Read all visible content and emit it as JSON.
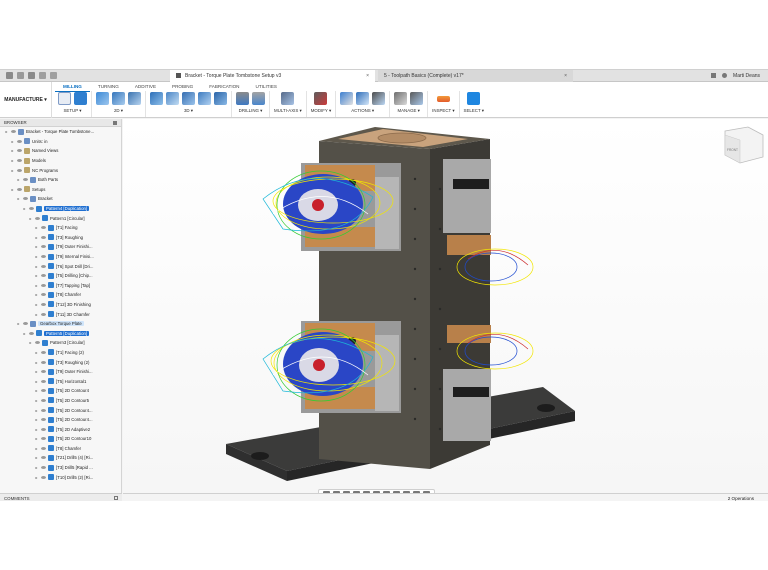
{
  "titlebar": {
    "active_tab": "Bracket - Torque Plate Tombstone Setup v3",
    "other_tab": "5 - Toolpath Basics (Complete) v17*",
    "user": "Marti Deans",
    "close": "×"
  },
  "ribbon": {
    "workspace": "MANUFACTURE ▾",
    "tabs": [
      "MILLING",
      "TURNING",
      "ADDITIVE",
      "PROBING",
      "FABRICATION",
      "UTILITIES"
    ],
    "groups": [
      "SETUP ▾",
      "2D ▾",
      "3D ▾",
      "DRILLING ▾",
      "MULTI-AXIS ▾",
      "MODIFY ▾",
      "ACTIONS ▾",
      "MANAGE ▾",
      "INSPECT ▾",
      "SELECT ▾"
    ]
  },
  "browser": {
    "header": "BROWSER",
    "rows": [
      {
        "d": 0,
        "text": "Bracket - Torque Plate Tombstone...",
        "icon": "doc"
      },
      {
        "d": 1,
        "text": "Units: in",
        "icon": "doc"
      },
      {
        "d": 1,
        "text": "Named Views",
        "icon": "folder"
      },
      {
        "d": 1,
        "text": "Models",
        "icon": "folder"
      },
      {
        "d": 1,
        "text": "NC Programs",
        "icon": "folder"
      },
      {
        "d": 2,
        "text": "Both Parts",
        "icon": "doc"
      },
      {
        "d": 1,
        "text": "Setups",
        "icon": "folder"
      },
      {
        "d": 2,
        "text": "Bracket",
        "icon": "setup"
      },
      {
        "d": 3,
        "text": "Pattern4 [Duplication]",
        "icon": "tp",
        "style": "sel"
      },
      {
        "d": 4,
        "text": "Pattern1 [Circular]",
        "icon": "tp"
      },
      {
        "d": 5,
        "text": "[T1] Facing",
        "icon": "tp"
      },
      {
        "d": 5,
        "text": "[T3] Roughing",
        "icon": "tp"
      },
      {
        "d": 5,
        "text": "[T9] Outer Finishi...",
        "icon": "tp"
      },
      {
        "d": 5,
        "text": "[T9] Internal Finisi...",
        "icon": "tp"
      },
      {
        "d": 5,
        "text": "[T6] Spot Drill [Dri...",
        "icon": "tp"
      },
      {
        "d": 5,
        "text": "[T5] Drilling [Chip...",
        "icon": "tp"
      },
      {
        "d": 5,
        "text": "[T7] Tapping [Tap]",
        "icon": "tp"
      },
      {
        "d": 5,
        "text": "[T8] Chamfer",
        "icon": "tp"
      },
      {
        "d": 5,
        "text": "[T12] 3D Finishing",
        "icon": "tp"
      },
      {
        "d": 5,
        "text": "[T11] 3D Chamfer",
        "icon": "tp"
      },
      {
        "d": 2,
        "text": "Gearbox Torque Plate",
        "icon": "setup",
        "style": "hl"
      },
      {
        "d": 3,
        "text": "Pattern5 [Duplication]",
        "icon": "tp",
        "style": "sel"
      },
      {
        "d": 4,
        "text": "Pattern3 [Circular]",
        "icon": "tp"
      },
      {
        "d": 5,
        "text": "[T1] Facing (2)",
        "icon": "tp"
      },
      {
        "d": 5,
        "text": "[T3] Roughing (2)",
        "icon": "tp"
      },
      {
        "d": 5,
        "text": "[T9] Outer Finishi...",
        "icon": "tp"
      },
      {
        "d": 5,
        "text": "[T5] Horizontal1",
        "icon": "tp"
      },
      {
        "d": 5,
        "text": "[T5] 2D Contour4",
        "icon": "tp"
      },
      {
        "d": 5,
        "text": "[T5] 2D Contour5",
        "icon": "tp"
      },
      {
        "d": 5,
        "text": "[T5] 2D Contour4...",
        "icon": "tp"
      },
      {
        "d": 5,
        "text": "[T5] 2D Contour4...",
        "icon": "tp"
      },
      {
        "d": 5,
        "text": "[T5] 2D Adaptive2",
        "icon": "tp"
      },
      {
        "d": 5,
        "text": "[T5] 2D Contour10",
        "icon": "tp"
      },
      {
        "d": 5,
        "text": "[T8] Chamfer",
        "icon": "tp"
      },
      {
        "d": 5,
        "text": "[T21] Drill5 (4) [Ri...",
        "icon": "tp"
      },
      {
        "d": 5,
        "text": "[T3] Drill5 [Rapid ...",
        "icon": "tp"
      },
      {
        "d": 5,
        "text": "[T10] Drill5 (2) [Ri...",
        "icon": "tp"
      }
    ]
  },
  "comments_label": "COMMENTS",
  "status": {
    "operations": "2 Operations"
  },
  "viewcube": {
    "face": "FRONT"
  }
}
